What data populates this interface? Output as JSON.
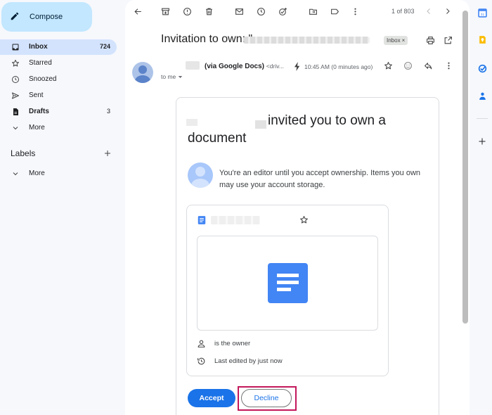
{
  "sidebar": {
    "compose_label": "Compose",
    "items": [
      {
        "label": "Inbox",
        "count": "724",
        "icon": "inbox-icon"
      },
      {
        "label": "Starred",
        "count": "",
        "icon": "star-icon"
      },
      {
        "label": "Snoozed",
        "count": "",
        "icon": "clock-icon"
      },
      {
        "label": "Sent",
        "count": "",
        "icon": "send-icon"
      },
      {
        "label": "Drafts",
        "count": "3",
        "icon": "draft-icon"
      },
      {
        "label": "More",
        "count": "",
        "icon": "chevron-down-icon"
      }
    ],
    "labels_heading": "Labels",
    "labels_more": "More"
  },
  "toolbar": {
    "pager": "1 of 803"
  },
  "email": {
    "subject_prefix": "Invitation to own: \"",
    "inbox_chip": "Inbox",
    "inbox_chip_close": "×",
    "sender_via": "(via Google Docs)",
    "sender_addr": "<driv...",
    "time": "10:45 AM (0 minutes ago)",
    "to_me": "to me"
  },
  "invite": {
    "title": "invited you to own a document",
    "message": "You're an editor until you accept ownership. Items you own may use your account storage.",
    "owner_text": "is the owner",
    "edited_text": "Last edited by just now",
    "accept_label": "Accept",
    "decline_label": "Decline"
  },
  "colors": {
    "accent": "#1a73e8",
    "highlight": "#c2185b",
    "compose_bg": "#c2e7ff"
  }
}
